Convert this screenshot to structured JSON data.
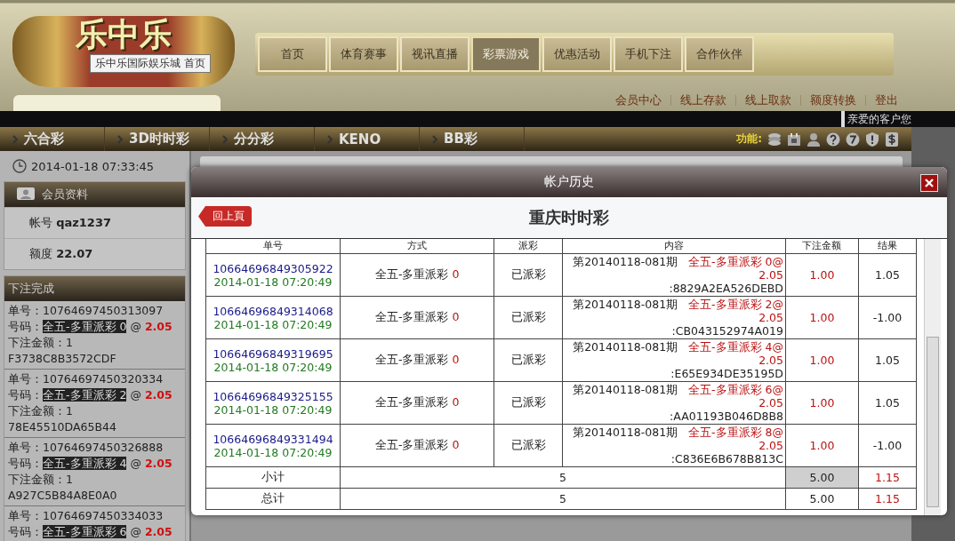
{
  "header": {
    "logo_text": "乐中乐",
    "tooltip": "乐中乐国际娱乐城 首页",
    "nav": [
      {
        "label": "首页",
        "selected": false
      },
      {
        "label": "体育赛事",
        "selected": false
      },
      {
        "label": "视讯直播",
        "selected": false
      },
      {
        "label": "彩票游戏",
        "selected": true
      },
      {
        "label": "优惠活动",
        "selected": false
      },
      {
        "label": "手机下注",
        "selected": false
      },
      {
        "label": "合作伙伴",
        "selected": false
      }
    ],
    "links": [
      "会员中心",
      "线上存款",
      "线上取款",
      "额度转换",
      "登出"
    ]
  },
  "ticker": "亲爱的客户您",
  "lottery_tabs": [
    "六合彩",
    "3D时时彩",
    "分分彩",
    "KENO",
    "BB彩"
  ],
  "functions_label": "功能:",
  "sidebar": {
    "clock": "2014-01-18 07:33:45",
    "member": {
      "title": "会员资料",
      "fields": [
        {
          "label": "帐号",
          "value": "qaz1237"
        },
        {
          "label": "额度",
          "value": "22.07"
        }
      ]
    },
    "bets": {
      "title": "下注完成",
      "items": [
        {
          "id_label": "单号：",
          "id": "10764697450313097",
          "num_label": "号码：",
          "num": "全五-多重派彩 0",
          "at": "@",
          "odds": "2.05",
          "amount": "下注金额：1",
          "code": "F3738C8B3572CDF"
        },
        {
          "id_label": "单号：",
          "id": "10764697450320334",
          "num_label": "号码：",
          "num": "全五-多重派彩 2",
          "at": "@",
          "odds": "2.05",
          "amount": "下注金额：1",
          "code": "78E45510DA65B44"
        },
        {
          "id_label": "单号：",
          "id": "10764697450326888",
          "num_label": "号码：",
          "num": "全五-多重派彩 4",
          "at": "@",
          "odds": "2.05",
          "amount": "下注金额：1",
          "code": "A927C5B84A8E0A0"
        },
        {
          "id_label": "单号：",
          "id": "10764697450334033",
          "num_label": "号码：",
          "num": "全五-多重派彩 6",
          "at": "@",
          "odds": "2.05"
        }
      ]
    }
  },
  "modal": {
    "title": "帐户历史",
    "back": "回上頁",
    "subtitle": "重庆时时彩",
    "columns": [
      "单号",
      "方式",
      "派彩",
      "内容",
      "下注金额",
      "结果"
    ],
    "rows": [
      {
        "id": "10664696849305922",
        "time": "2014-01-18 07:20:49",
        "method": "全五-多重派彩",
        "method_num": "0",
        "payout": "已派彩",
        "period": "第20140118-081期",
        "bet": "全五-多重派彩 0@",
        "odds": "2.05",
        "code": ":8829A2EA526DEBD",
        "amount": "1.00",
        "result": "1.05"
      },
      {
        "id": "10664696849314068",
        "time": "2014-01-18 07:20:49",
        "method": "全五-多重派彩",
        "method_num": "0",
        "payout": "已派彩",
        "period": "第20140118-081期",
        "bet": "全五-多重派彩 2@",
        "odds": "2.05",
        "code": ":CB043152974A019",
        "amount": "1.00",
        "result": "-1.00"
      },
      {
        "id": "10664696849319695",
        "time": "2014-01-18 07:20:49",
        "method": "全五-多重派彩",
        "method_num": "0",
        "payout": "已派彩",
        "period": "第20140118-081期",
        "bet": "全五-多重派彩 4@",
        "odds": "2.05",
        "code": ":E65E934DE35195D",
        "amount": "1.00",
        "result": "1.05"
      },
      {
        "id": "10664696849325155",
        "time": "2014-01-18 07:20:49",
        "method": "全五-多重派彩",
        "method_num": "0",
        "payout": "已派彩",
        "period": "第20140118-081期",
        "bet": "全五-多重派彩 6@",
        "odds": "2.05",
        "code": ":AA01193B046D8B8",
        "amount": "1.00",
        "result": "1.05"
      },
      {
        "id": "10664696849331494",
        "time": "2014-01-18 07:20:49",
        "method": "全五-多重派彩",
        "method_num": "0",
        "payout": "已派彩",
        "period": "第20140118-081期",
        "bet": "全五-多重派彩 8@",
        "odds": "2.05",
        "code": ":C836E6B678B813C",
        "amount": "1.00",
        "result": "-1.00"
      }
    ],
    "totals": [
      {
        "label": "小计",
        "count": "5",
        "amount": "5.00",
        "result": "1.15",
        "highlighted": true
      },
      {
        "label": "总计",
        "count": "5",
        "amount": "5.00",
        "result": "1.15",
        "highlighted": false
      }
    ]
  }
}
